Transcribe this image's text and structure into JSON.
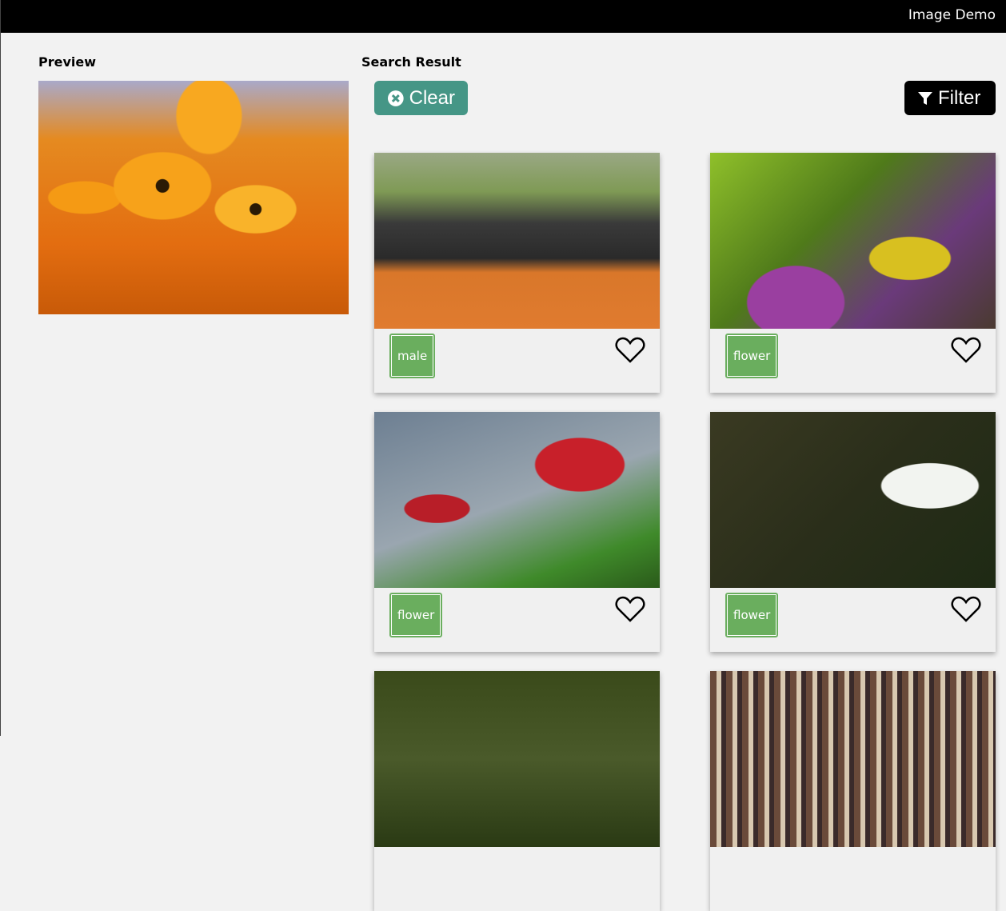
{
  "header": {
    "title": "Image Demo"
  },
  "preview": {
    "label": "Preview"
  },
  "search": {
    "label": "Search Result",
    "clear_label": "Clear",
    "filter_label": "Filter"
  },
  "results": [
    {
      "tag": "male"
    },
    {
      "tag": "flower"
    },
    {
      "tag": "flower"
    },
    {
      "tag": "flower"
    },
    {
      "tag": ""
    },
    {
      "tag": ""
    }
  ],
  "colors": {
    "clear": "#459686",
    "filter": "#000000",
    "tag": "#6aae5e",
    "header": "#000000"
  }
}
